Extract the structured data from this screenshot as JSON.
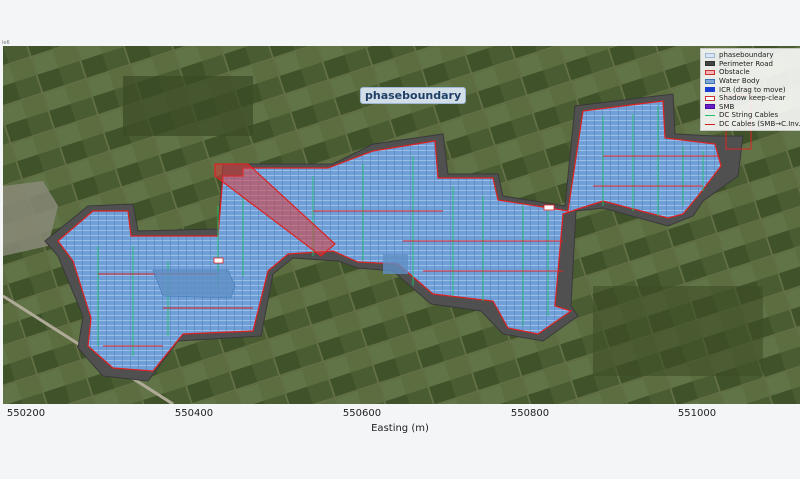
{
  "map": {
    "tag_label": "phaseboundary",
    "x_axis_label": "Easting (m)",
    "x_ticks": [
      "550200",
      "550400",
      "550600",
      "550800",
      "551000"
    ],
    "top_left_mark": "le6",
    "legend": [
      {
        "label": "phaseboundary",
        "kind": "fill",
        "color": "#d9e6f5",
        "border": "#9fb7d4"
      },
      {
        "label": "Perimeter Road",
        "kind": "fill",
        "color": "#444444",
        "border": "#333333"
      },
      {
        "label": "Obstacle",
        "kind": "fill",
        "color": "#f4b4b4",
        "border": "#d03030"
      },
      {
        "label": "Water Body",
        "kind": "fill",
        "color": "#7fa9d9",
        "border": "#3a6fb0"
      },
      {
        "label": "ICR (drag to move)",
        "kind": "fill",
        "color": "#1a3fd0",
        "border": "#1a3fd0"
      },
      {
        "label": "Shadow keep-clear",
        "kind": "fill",
        "color": "#ffffff",
        "border": "#d03030"
      },
      {
        "label": "SMB",
        "kind": "fill",
        "color": "#6a1fc0",
        "border": "#4a0fa0"
      },
      {
        "label": "DC String Cables",
        "kind": "line",
        "color": "#22c06a"
      },
      {
        "label": "DC Cables (SMB→C.Inv.)",
        "kind": "line",
        "color": "#d02020"
      }
    ],
    "colors": {
      "satellite": "#4c5e34",
      "panels": "#6f9fd6",
      "panel_rows": "#8cb6e6",
      "perimeter": "#505050",
      "boundary": "#dd2222",
      "cables": "#22c06a",
      "obstacle": "#d83a3a"
    }
  }
}
